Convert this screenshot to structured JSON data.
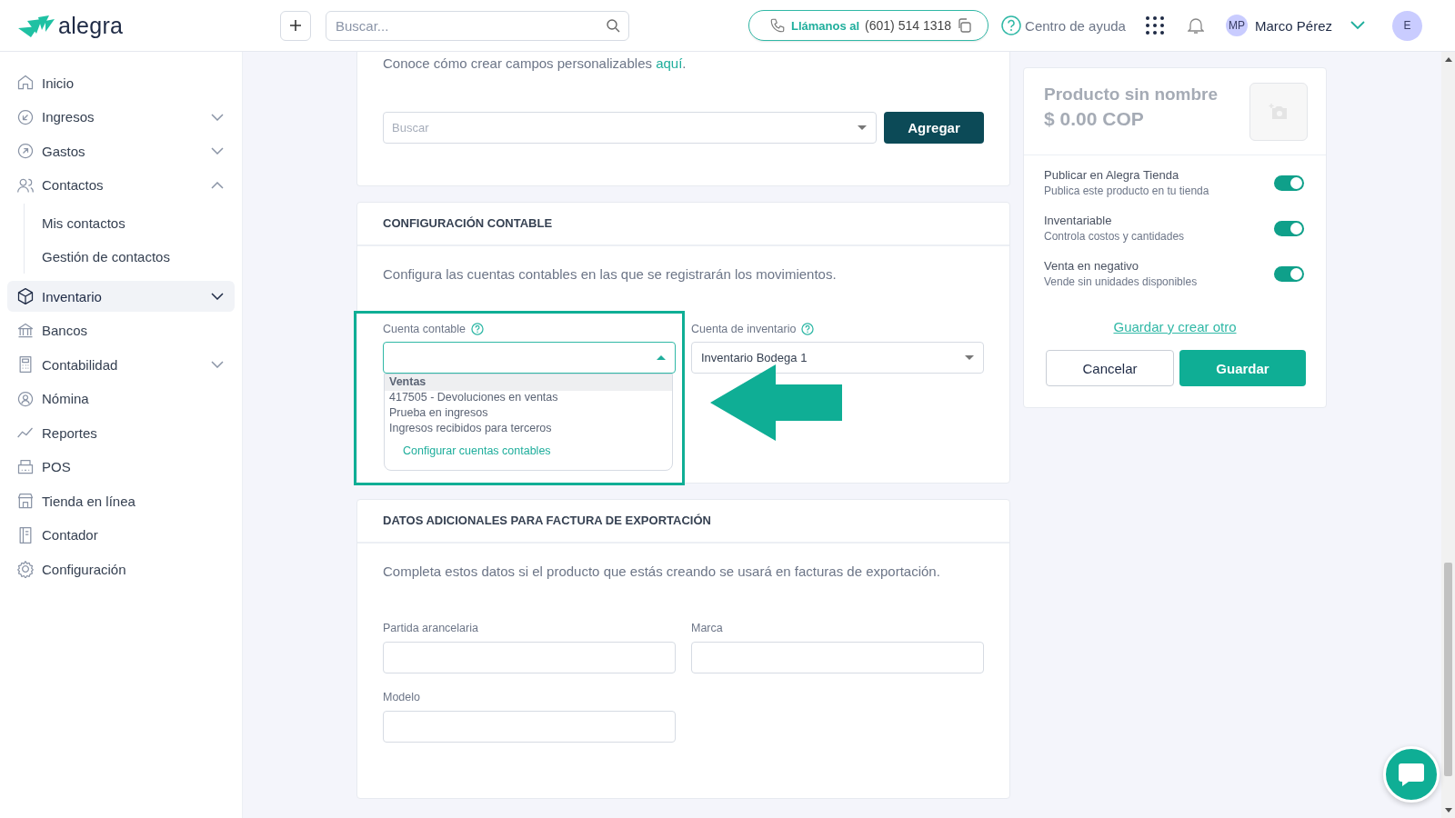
{
  "topbar": {
    "logo": "alegra",
    "search_placeholder": "Buscar...",
    "phone_label": "Llámanos al",
    "phone": "(601) 514 1318",
    "help": "Centro de ayuda",
    "user_initials": "MP",
    "user_name": "Marco Pérez",
    "account_initial": "E"
  },
  "sidebar": {
    "items": [
      {
        "label": "Inicio",
        "selected": false
      },
      {
        "label": "Ingresos",
        "selected": false,
        "expanded": false
      },
      {
        "label": "Gastos",
        "selected": false,
        "expanded": false
      },
      {
        "label": "Contactos",
        "selected": false,
        "expanded": true,
        "children": [
          {
            "label": "Mis contactos",
            "selected": false
          },
          {
            "label": "Gestión de contactos",
            "selected": false
          }
        ]
      },
      {
        "label": "Inventario",
        "selected": true,
        "expanded": false
      },
      {
        "label": "Bancos",
        "selected": false
      },
      {
        "label": "Contabilidad",
        "selected": false,
        "expanded": false
      },
      {
        "label": "Nómina",
        "selected": false
      },
      {
        "label": "Reportes",
        "selected": false
      },
      {
        "label": "POS",
        "selected": false
      },
      {
        "label": "Tienda en línea",
        "selected": false
      },
      {
        "label": "Contador",
        "selected": false
      },
      {
        "label": "Configuración",
        "selected": false
      }
    ]
  },
  "custom_fields": {
    "hint": "Conoce cómo crear campos personalizables ",
    "hint_link": "aquí",
    "hint_end": ".",
    "select_placeholder": "Buscar",
    "add_button": "Agregar"
  },
  "accounting": {
    "title": "CONFIGURACIÓN CONTABLE",
    "description": "Configura las cuentas contables en las que se registrarán los movimientos.",
    "account_field": {
      "label": "Cuenta contable",
      "expanded": true,
      "group": "Ventas",
      "options": [
        "417505 - Devoluciones en ventas",
        "Prueba en ingresos",
        "Ingresos recibidos para terceros"
      ],
      "footer_link": "Configurar cuentas contables"
    },
    "inventory_field": {
      "label": "Cuenta de inventario",
      "value": "Inventario Bodega 1"
    }
  },
  "export": {
    "title": "DATOS ADICIONALES PARA FACTURA DE EXPORTACIÓN",
    "description": "Completa estos datos si el producto que estás creando se usará en facturas de exportación.",
    "fields": [
      {
        "label": "Partida arancelaria"
      },
      {
        "label": "Marca"
      },
      {
        "label": "Modelo"
      }
    ]
  },
  "summary": {
    "name": "Producto sin nombre",
    "price": "$ 0.00 COP",
    "toggles": [
      {
        "title": "Publicar en Alegra Tienda",
        "subtitle": "Publica este producto en tu tienda",
        "on": true
      },
      {
        "title": "Inventariable",
        "subtitle": "Controla costos y cantidades",
        "on": true
      },
      {
        "title": "Venta en negativo",
        "subtitle": "Vende sin unidades disponibles",
        "on": true
      }
    ],
    "save_and_new": "Guardar y crear otro",
    "cancel": "Cancelar",
    "save": "Guardar"
  }
}
